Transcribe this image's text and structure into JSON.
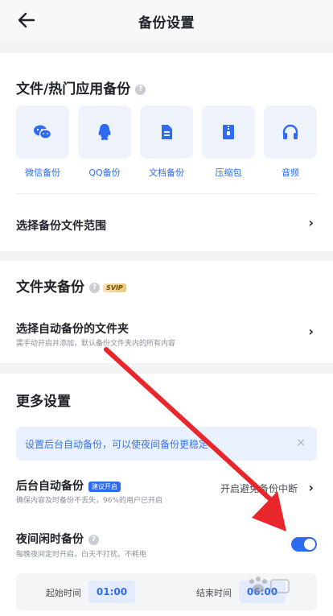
{
  "header": {
    "title": "备份设置"
  },
  "hot_apps": {
    "title": "文件/热门应用备份",
    "help_icon": "?",
    "items": [
      {
        "label": "微信备份",
        "icon": "wechat-icon"
      },
      {
        "label": "QQ备份",
        "icon": "qq-icon"
      },
      {
        "label": "文档备份",
        "icon": "document-icon"
      },
      {
        "label": "压缩包",
        "icon": "zip-icon"
      },
      {
        "label": "音频",
        "icon": "headphones-icon"
      }
    ],
    "range_row": {
      "label": "选择备份文件范围",
      "chevron": "›"
    }
  },
  "folder_backup": {
    "title": "文件夹备份",
    "help_icon": "?",
    "badge": "SVIP",
    "row": {
      "label": "选择自动备份的文件夹",
      "subtitle": "需手动开启并添加，默认备份文件夹内的所有内容",
      "chevron": "›"
    }
  },
  "more_settings": {
    "title": "更多设置",
    "tip": {
      "text": "设置后台自动备份，可以使夜间备份更稳定",
      "close": "×"
    },
    "background_backup": {
      "label": "后台自动备份",
      "badge": "建议开启",
      "subtitle": "确保内容及时备份不丢失，96%的用户已开启",
      "status": "开启避免备份中断",
      "chevron": "›"
    },
    "night_backup": {
      "label": "夜间闲时备份",
      "help_icon": "?",
      "subtitle": "每晚夜间定时开启，白天不打扰、不耗电",
      "enabled": true
    },
    "time_range": {
      "start_label": "起始时间",
      "start_value": "01:00",
      "end_label": "结束时间",
      "end_value": "06:00"
    }
  },
  "colors": {
    "accent": "#2f6bf2",
    "annotation_arrow": "#e8262b"
  }
}
